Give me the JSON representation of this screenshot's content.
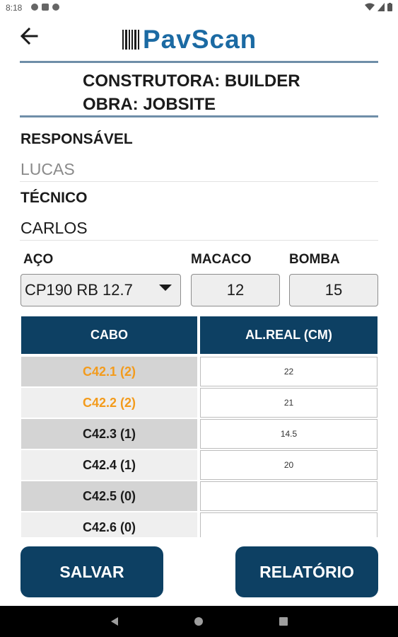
{
  "status_bar": {
    "time": "8:18"
  },
  "header": {
    "app_name": "PavScan"
  },
  "project": {
    "constructor_line": "CONSTRUTORA: BUILDER",
    "site_line": "OBRA: JOBSITE"
  },
  "fields": {
    "responsible_label": "RESPONSÁVEL",
    "responsible_placeholder": "LUCAS",
    "technician_label": "TÉCNICO",
    "technician_value": "CARLOS"
  },
  "equipment": {
    "steel_label": "AÇO",
    "steel_value": "CP190 RB 12.7",
    "jack_label": "MACACO",
    "jack_value": "12",
    "pump_label": "BOMBA",
    "pump_value": "15"
  },
  "table": {
    "headers": [
      "CABO",
      "AL.REAL (CM)"
    ],
    "rows": [
      {
        "cabo": "C42.1 (2)",
        "al_real": "22",
        "highlight": true
      },
      {
        "cabo": "C42.2 (2)",
        "al_real": "21",
        "highlight": true
      },
      {
        "cabo": "C42.3 (1)",
        "al_real": "14.5",
        "highlight": false
      },
      {
        "cabo": "C42.4 (1)",
        "al_real": "20",
        "highlight": false
      },
      {
        "cabo": "C42.5 (0)",
        "al_real": "",
        "highlight": false
      },
      {
        "cabo": "C42.6 (0)",
        "al_real": "",
        "highlight": false
      }
    ]
  },
  "buttons": {
    "save": "SALVAR",
    "report": "RELATÓRIO"
  },
  "colors": {
    "primary": "#0d4063",
    "brand": "#1b6aa3",
    "highlight_text": "#f39b1c",
    "row_dark": "#d4d4d4",
    "row_light": "#efefef"
  }
}
